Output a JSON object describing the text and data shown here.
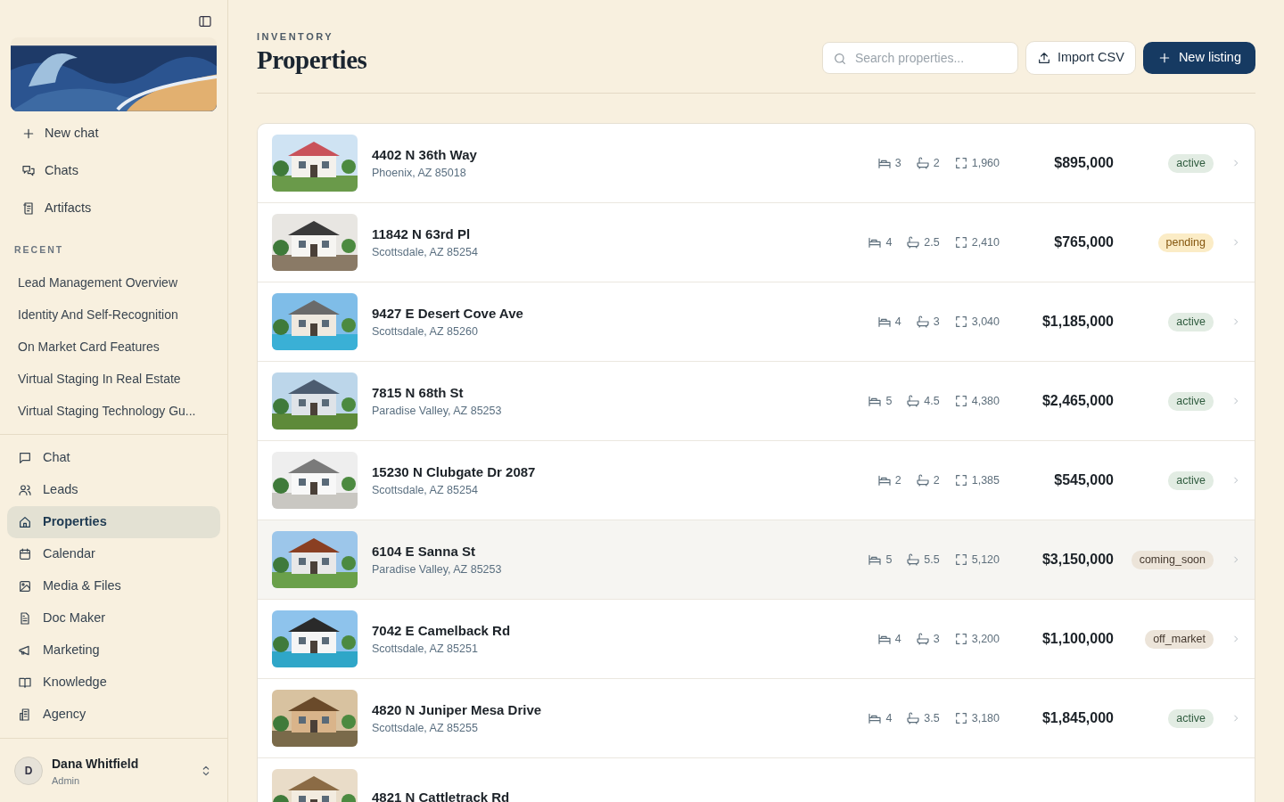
{
  "sidebar": {
    "top_actions": [
      {
        "label": "New chat"
      },
      {
        "label": "Chats"
      },
      {
        "label": "Artifacts"
      }
    ],
    "recent_heading": "RECENT",
    "recent": [
      "Lead Management Overview",
      "Identity And Self-Recognition",
      "On Market Card Features",
      "Virtual Staging In Real Estate",
      "Virtual Staging Technology Gu..."
    ],
    "nav": [
      {
        "label": "Chat",
        "selected": false
      },
      {
        "label": "Leads",
        "selected": false
      },
      {
        "label": "Properties",
        "selected": true
      },
      {
        "label": "Calendar",
        "selected": false
      },
      {
        "label": "Media & Files",
        "selected": false
      },
      {
        "label": "Doc Maker",
        "selected": false
      },
      {
        "label": "Marketing",
        "selected": false
      },
      {
        "label": "Knowledge",
        "selected": false
      },
      {
        "label": "Agency",
        "selected": false
      }
    ],
    "user": {
      "initial": "D",
      "name": "Dana Whitfield",
      "role": "Admin"
    }
  },
  "header": {
    "eyebrow": "INVENTORY",
    "title": "Properties",
    "search": {
      "placeholder": "Search properties..."
    },
    "buttons": [
      "Import CSV",
      "New listing"
    ]
  },
  "properties": [
    {
      "address": "4402 N 36th Way",
      "city": "Phoenix, AZ 85018",
      "beds": "3",
      "baths": "2",
      "sqft": "1,960",
      "price": "$895,000",
      "status": "active",
      "highlighted": false
    },
    {
      "address": "11842 N 63rd Pl",
      "city": "Scottsdale, AZ 85254",
      "beds": "4",
      "baths": "2.5",
      "sqft": "2,410",
      "price": "$765,000",
      "status": "pending",
      "highlighted": false
    },
    {
      "address": "9427 E Desert Cove Ave",
      "city": "Scottsdale, AZ 85260",
      "beds": "4",
      "baths": "3",
      "sqft": "3,040",
      "price": "$1,185,000",
      "status": "active",
      "highlighted": false
    },
    {
      "address": "7815 N 68th St",
      "city": "Paradise Valley, AZ 85253",
      "beds": "5",
      "baths": "4.5",
      "sqft": "4,380",
      "price": "$2,465,000",
      "status": "active",
      "highlighted": false
    },
    {
      "address": "15230 N Clubgate Dr 2087",
      "city": "Scottsdale, AZ 85254",
      "beds": "2",
      "baths": "2",
      "sqft": "1,385",
      "price": "$545,000",
      "status": "active",
      "highlighted": false
    },
    {
      "address": "6104 E Sanna St",
      "city": "Paradise Valley, AZ 85253",
      "beds": "5",
      "baths": "5.5",
      "sqft": "5,120",
      "price": "$3,150,000",
      "status": "coming_soon",
      "highlighted": true
    },
    {
      "address": "7042 E Camelback Rd",
      "city": "Scottsdale, AZ 85251",
      "beds": "4",
      "baths": "3",
      "sqft": "3,200",
      "price": "$1,100,000",
      "status": "off_market",
      "highlighted": false
    },
    {
      "address": "4820 N Juniper Mesa Drive",
      "city": "Scottsdale, AZ 85255",
      "beds": "4",
      "baths": "3.5",
      "sqft": "3,180",
      "price": "$1,845,000",
      "status": "active",
      "highlighted": false
    },
    {
      "address": "4821 N Cattletrack Rd"
    }
  ]
}
